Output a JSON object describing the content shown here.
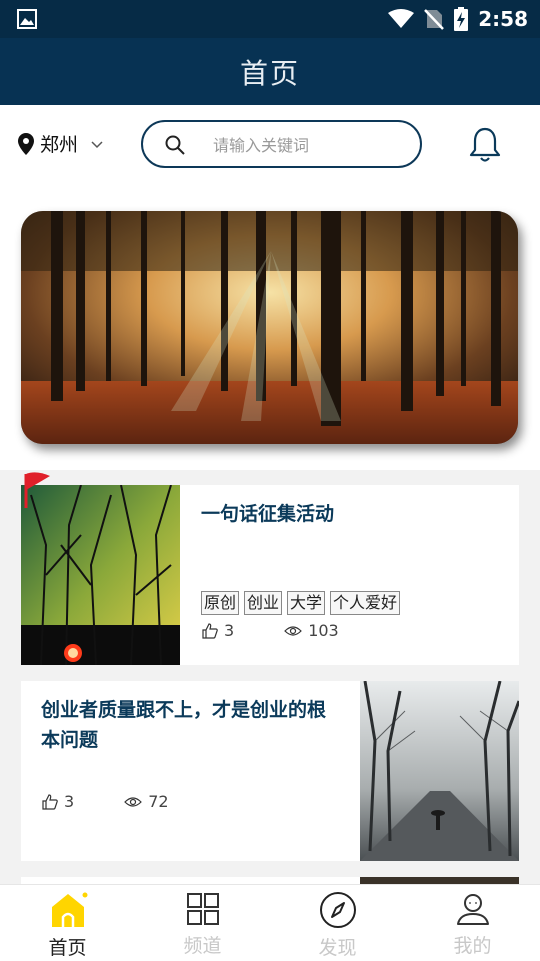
{
  "status_bar": {
    "time": "2:58",
    "icons": [
      "image-icon",
      "wifi-icon",
      "no-sim-icon",
      "battery-charging-icon"
    ]
  },
  "app_bar": {
    "title": "首页"
  },
  "location": {
    "city": "郑州"
  },
  "search": {
    "placeholder": "请输入关键词"
  },
  "articles": [
    {
      "title": "一句话征集活动",
      "tags": [
        "原创",
        "创业",
        "大学",
        "个人爱好"
      ],
      "likes": "3",
      "views": "103"
    },
    {
      "title": "创业者质量跟不上，才是创业的根本问题",
      "likes": "3",
      "views": "72"
    }
  ],
  "bottom_nav": [
    {
      "label": "首页",
      "icon": "home-icon",
      "active": true
    },
    {
      "label": "频道",
      "icon": "grid-icon"
    },
    {
      "label": "发现",
      "icon": "compass-icon"
    },
    {
      "label": "我的",
      "icon": "user-icon"
    }
  ],
  "colors": {
    "header": "#073253",
    "accent": "#ffd500",
    "title_text": "#0b3a5a"
  }
}
